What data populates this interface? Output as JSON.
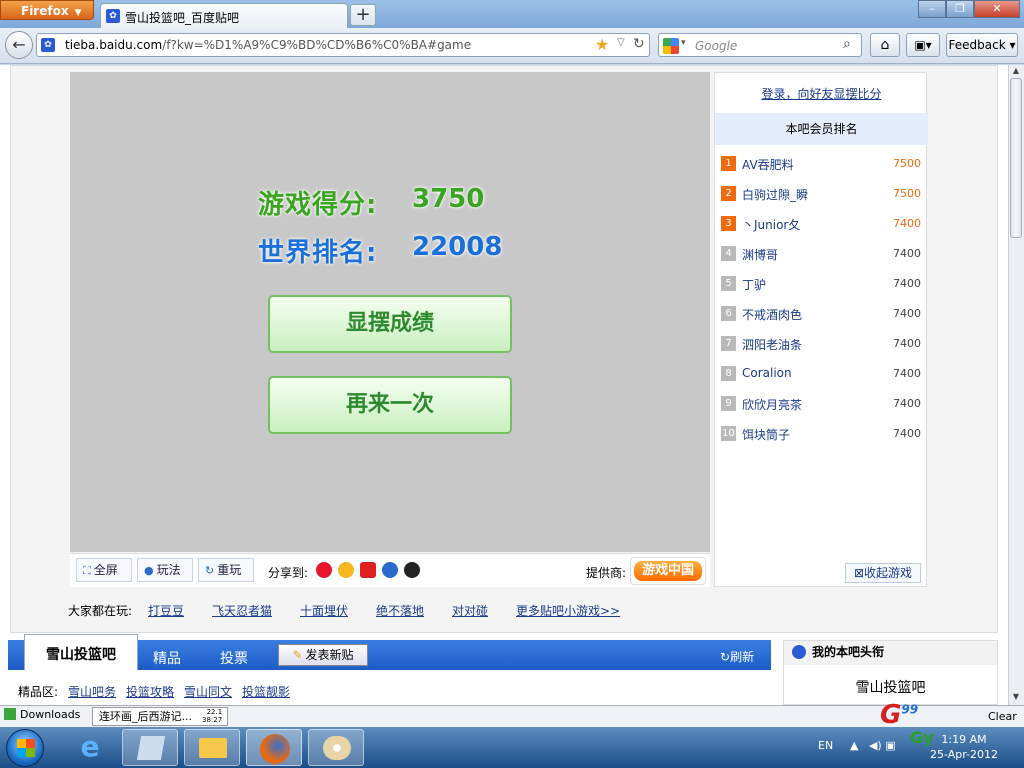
{
  "browser": {
    "app_button": "Firefox",
    "tab_title": "雪山投篮吧_百度贴吧",
    "url_host": "tieba.baidu.com",
    "url_path": "/f?kw=%D1%A9%C9%BD%CD%B6%C0%BA#game",
    "search_placeholder": "Google",
    "feedback_label": "Feedback"
  },
  "game": {
    "score_label": "游戏得分:",
    "score_value": "3750",
    "rank_label": "世界排名:",
    "rank_value": "22008",
    "show_button": "显摆成绩",
    "again_button": "再来一次",
    "toolbar": {
      "fullscreen": "全屏",
      "howto": "玩法",
      "replay": "重玩",
      "share": "分享到:",
      "provider": "提供商:",
      "provider_logo": "游戏中国"
    },
    "playing_label": "大家都在玩:",
    "playing_links": [
      "打豆豆",
      "飞天忍者猫",
      "十面埋伏",
      "绝不落地",
      "对对碰",
      "更多贴吧小游戏>>"
    ]
  },
  "ranking": {
    "login_link": "登录，向好友显摆比分",
    "title": "本吧会员排名",
    "rows": [
      {
        "rank": "1",
        "name": "AV吞肥料",
        "score": "7500"
      },
      {
        "rank": "2",
        "name": "白驹过隙_瞬",
        "score": "7500"
      },
      {
        "rank": "3",
        "name": "丶Junior夂",
        "score": "7400"
      },
      {
        "rank": "4",
        "name": "渊博哥",
        "score": "7400"
      },
      {
        "rank": "5",
        "name": "丁驴",
        "score": "7400"
      },
      {
        "rank": "6",
        "name": "不戒酒肉色",
        "score": "7400"
      },
      {
        "rank": "7",
        "name": "泗阳老油条",
        "score": "7400"
      },
      {
        "rank": "8",
        "name": "Coralion",
        "score": "7400"
      },
      {
        "rank": "9",
        "name": "欣欣月亮茶",
        "score": "7400"
      },
      {
        "rank": "10",
        "name": "饵块筒子",
        "score": "7400"
      }
    ],
    "collapse_button": "收起游戏"
  },
  "forum": {
    "tabs": [
      "雪山投篮吧",
      "精品",
      "投票"
    ],
    "post_button": "发表新贴",
    "refresh": "刷新",
    "featured_label": "精品区:",
    "featured_links": [
      "雪山吧务",
      "投篮攻略",
      "雪山同文",
      "投篮靓影"
    ],
    "my_box_title": "我的本吧头衔",
    "my_box_name": "雪山投篮吧"
  },
  "downloads": {
    "label": "Downloads",
    "item": "连环画_后西游记...",
    "progress_top": "22.1",
    "progress_bottom": "38:27",
    "clear": "Clear"
  },
  "taskbar": {
    "lang": "EN",
    "time": "1:19 AM",
    "date": "25-Apr-2012"
  },
  "watermark": {
    "main": "G",
    "sub": "99",
    "tag": "Gy"
  }
}
